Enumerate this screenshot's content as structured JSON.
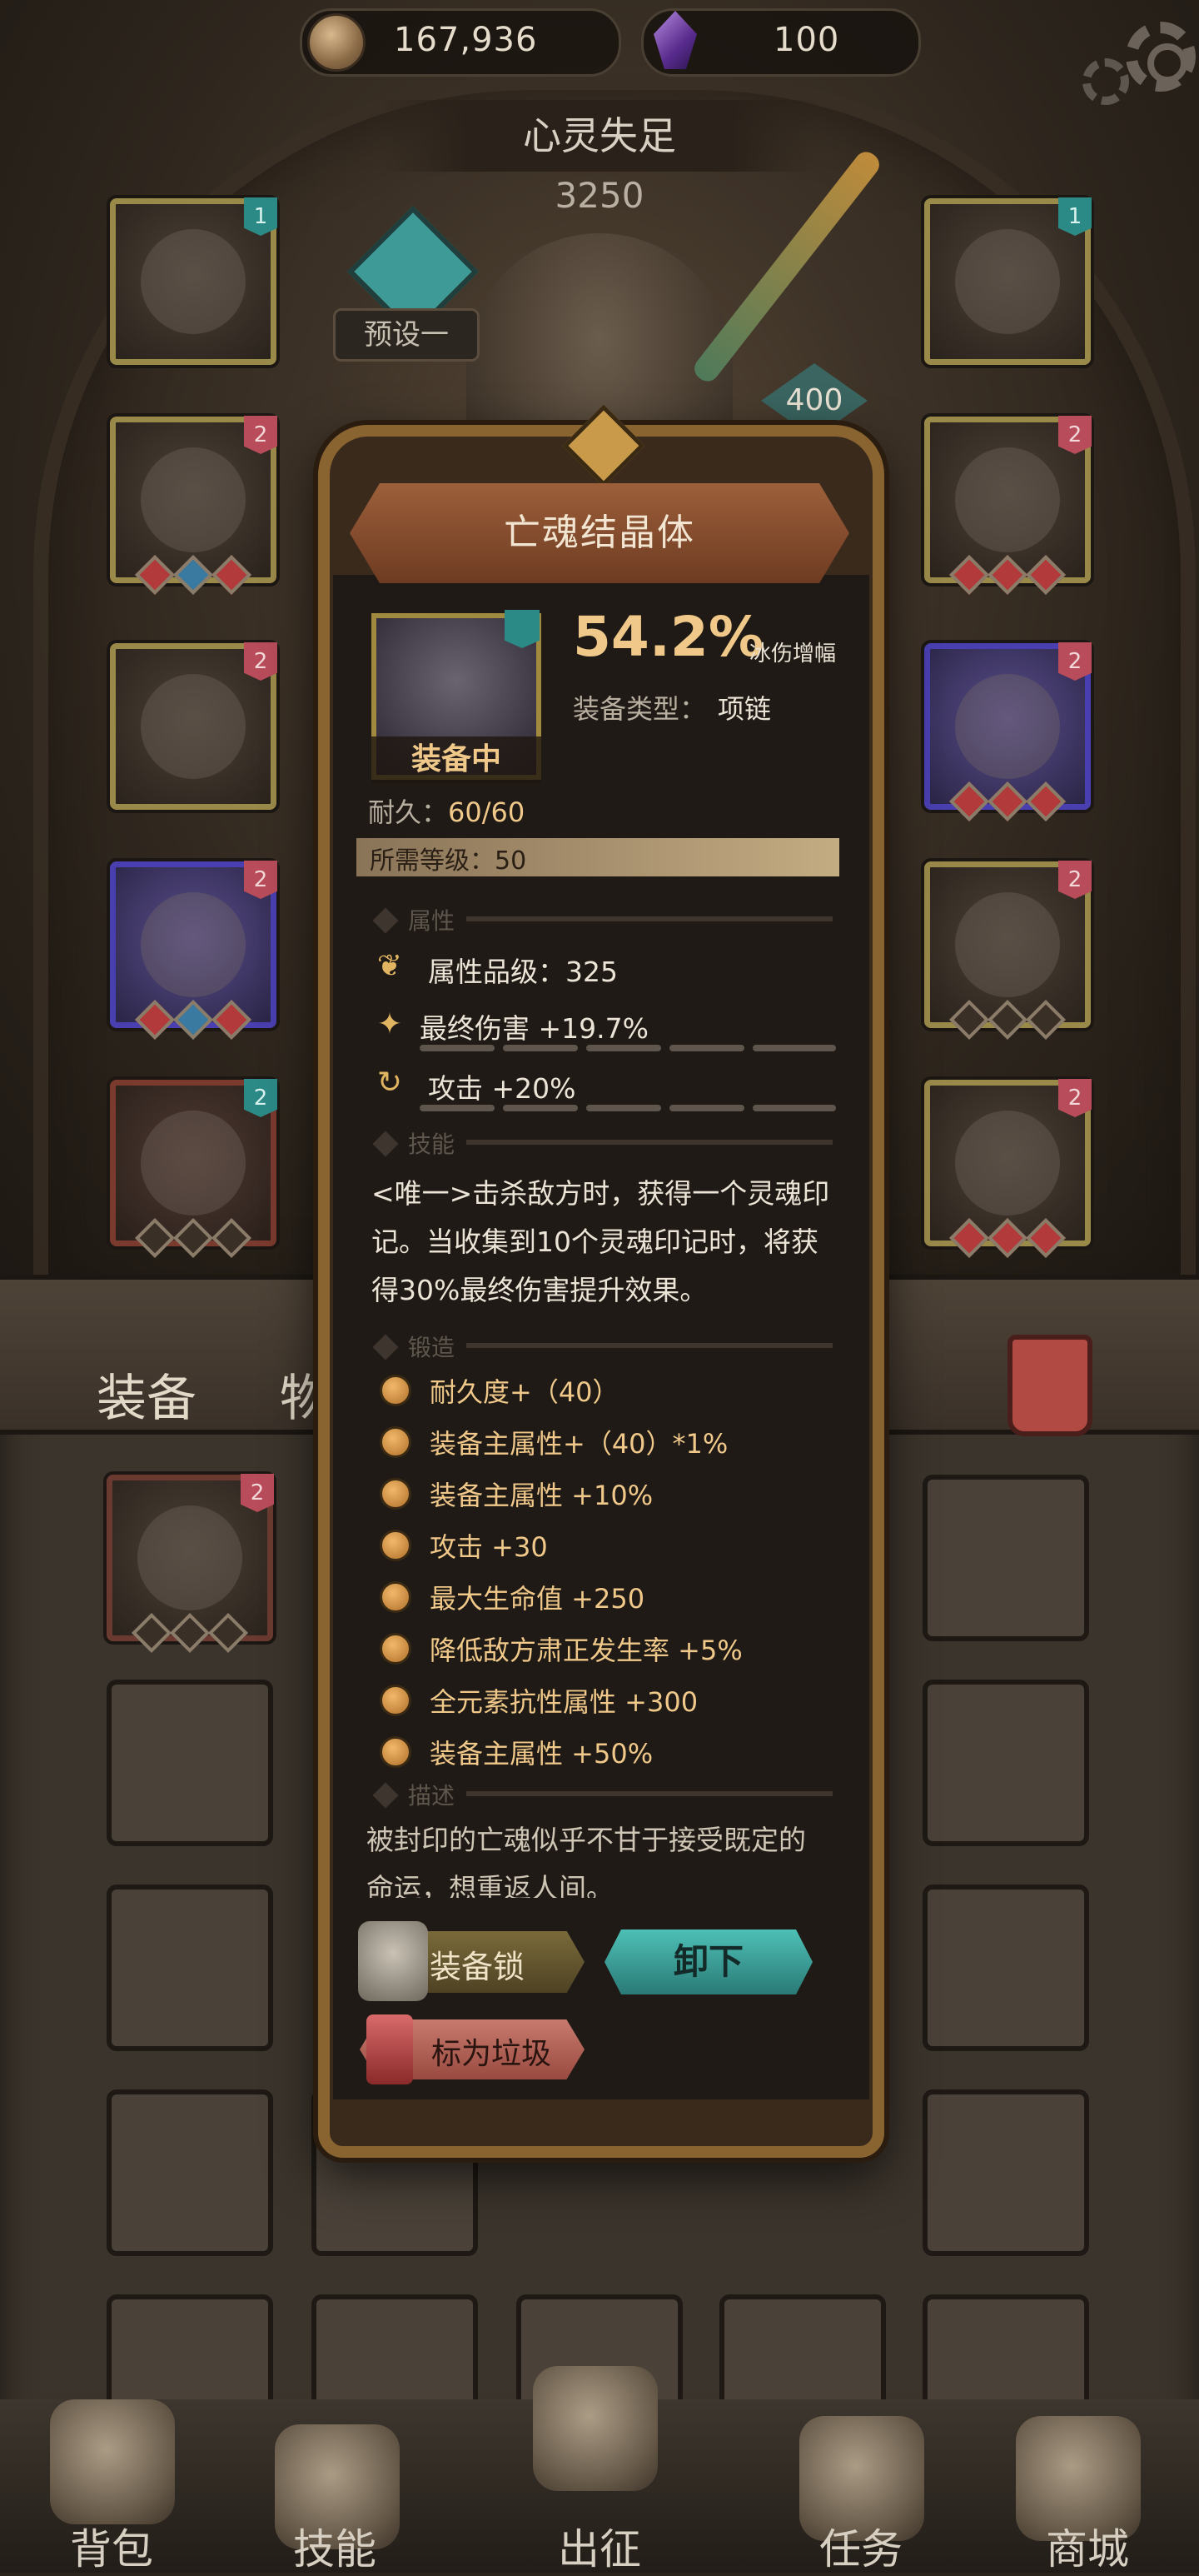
{
  "topbar": {
    "coins": "167,936",
    "gems": "100",
    "coin_icon": "coin-icon",
    "gem_icon": "purple-crystal-icon",
    "settings_icon": "gear-icon"
  },
  "character": {
    "name": "心灵失足",
    "score": "3250",
    "preset": "预设一",
    "weapon_level": "400"
  },
  "slots_left": [
    {
      "level": "1",
      "color": "teal"
    },
    {
      "level": "2",
      "color": "red"
    },
    {
      "level": "2",
      "color": "red"
    },
    {
      "level": "2",
      "color": "red"
    },
    {
      "level": "2",
      "color": "teal"
    }
  ],
  "slots_right": [
    {
      "level": "1",
      "color": "teal"
    },
    {
      "level": "2",
      "color": "red"
    },
    {
      "level": "2",
      "color": "red"
    },
    {
      "level": "2",
      "color": "red"
    },
    {
      "level": "2",
      "color": "red"
    }
  ],
  "bag": {
    "tab_equipment": "装备",
    "tab_items": "物品",
    "first_item_level": "2"
  },
  "tooltip": {
    "title": "亡魂结晶体",
    "equipped_label": "装备中",
    "item_level": "1",
    "main_stat_value": "54.2%",
    "main_stat_label": "冰伤增幅",
    "type_label": "装备类型：",
    "type_value": "项链",
    "durability_label": "耐久：",
    "durability_value": "60/60",
    "required_level": "所需等级：50",
    "section_attributes": "属性",
    "attr_grade": "属性品级：325",
    "attr_final_damage": "最终伤害 +19.7%",
    "attr_attack": "攻击 +20%",
    "section_skill": "技能",
    "skill_text_1": "<唯一>击杀敌方时，获得一个灵魂印",
    "skill_text_2": "记。当收集到10个灵魂印记时，将获",
    "skill_text_3": "得30%最终伤害提升效果。",
    "section_forge": "锻造",
    "forge": [
      "耐久度+（40）",
      "装备主属性+（40）*1%",
      "装备主属性 +10%",
      "攻击 +30",
      "最大生命值 +250",
      "降低敌方肃正发生率 +5%",
      "全元素抗性属性 +300",
      "装备主属性 +50%"
    ],
    "section_desc": "描述",
    "flavor_1": "被封印的亡魂似乎不甘于接受既定的",
    "flavor_2": "命运，想重返人间。",
    "btn_lock": "装备锁",
    "btn_unequip": "卸下",
    "btn_junk": "标为垃圾"
  },
  "nav": {
    "bag": "背包",
    "skills": "技能",
    "expedition": "出征",
    "quests": "任务",
    "shop": "商城"
  }
}
